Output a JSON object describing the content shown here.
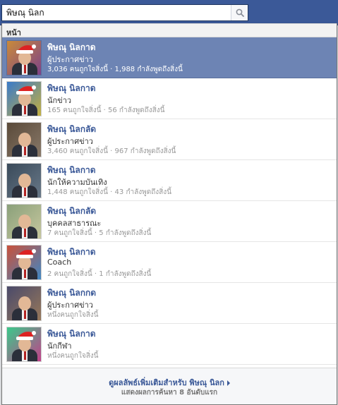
{
  "search": {
    "value": "พิษณุ นิลก",
    "icon": "search-icon"
  },
  "section": {
    "header": "หน้า"
  },
  "results": [
    {
      "name": "พิษณุ นิลกาด",
      "category": "ผู้ประกาศข่าว",
      "stats": "3,036 คนถูกใจสิ่งนี้ · 1,988 กำลังพูดถึงสิ่งนี้",
      "selected": true,
      "hat": true
    },
    {
      "name": "พิษณุ นิลกาด",
      "category": "นักข่าว",
      "stats": "165 คนถูกใจสิ่งนี้ · 56 กำลังพูดถึงสิ่งนี้",
      "selected": false,
      "hat": true
    },
    {
      "name": "พิษณุ นิลกลัด",
      "category": "ผู้ประกาศข่าว",
      "stats": "3,460 คนถูกใจสิ่งนี้ · 967 กำลังพูดถึงสิ่งนี้",
      "selected": false,
      "hat": false
    },
    {
      "name": "พิษณุ นิลกาด",
      "category": "นักให้ความบันเทิง",
      "stats": "1,448 คนถูกใจสิ่งนี้ · 43 กำลังพูดถึงสิ่งนี้",
      "selected": false,
      "hat": false
    },
    {
      "name": "พิษณุ นิลกลัด",
      "category": "บุคคลสาธารณะ",
      "stats": "7 คนถูกใจสิ่งนี้ · 5 กำลังพูดถึงสิ่งนี้",
      "selected": false,
      "hat": false
    },
    {
      "name": "พิษณุ นิลกาด",
      "category": "Coach",
      "stats": "2 คนถูกใจสิ่งนี้ · 1 กำลังพูดถึงสิ่งนี้",
      "selected": false,
      "hat": true
    },
    {
      "name": "พิษณุ นิลกกด",
      "category": "ผู้ประกาศข่าว",
      "stats": "หนึ่งคนถูกใจสิ่งนี้",
      "selected": false,
      "hat": false
    },
    {
      "name": "พิษณุ นิลกาด",
      "category": "นักกีฬา",
      "stats": "หนึ่งคนถูกใจสิ่งนี้",
      "selected": false,
      "hat": true
    }
  ],
  "footer": {
    "link": "ดูผลลัพธ์เพิ่มเติมสำหรับ พิษณุ นิลก",
    "sub": "แสดงผลการค้นหา 8 อันดับแรก"
  },
  "colors": {
    "topbar": "#3b5998",
    "selected_row": "#6d84b4",
    "link": "#3b5998"
  }
}
